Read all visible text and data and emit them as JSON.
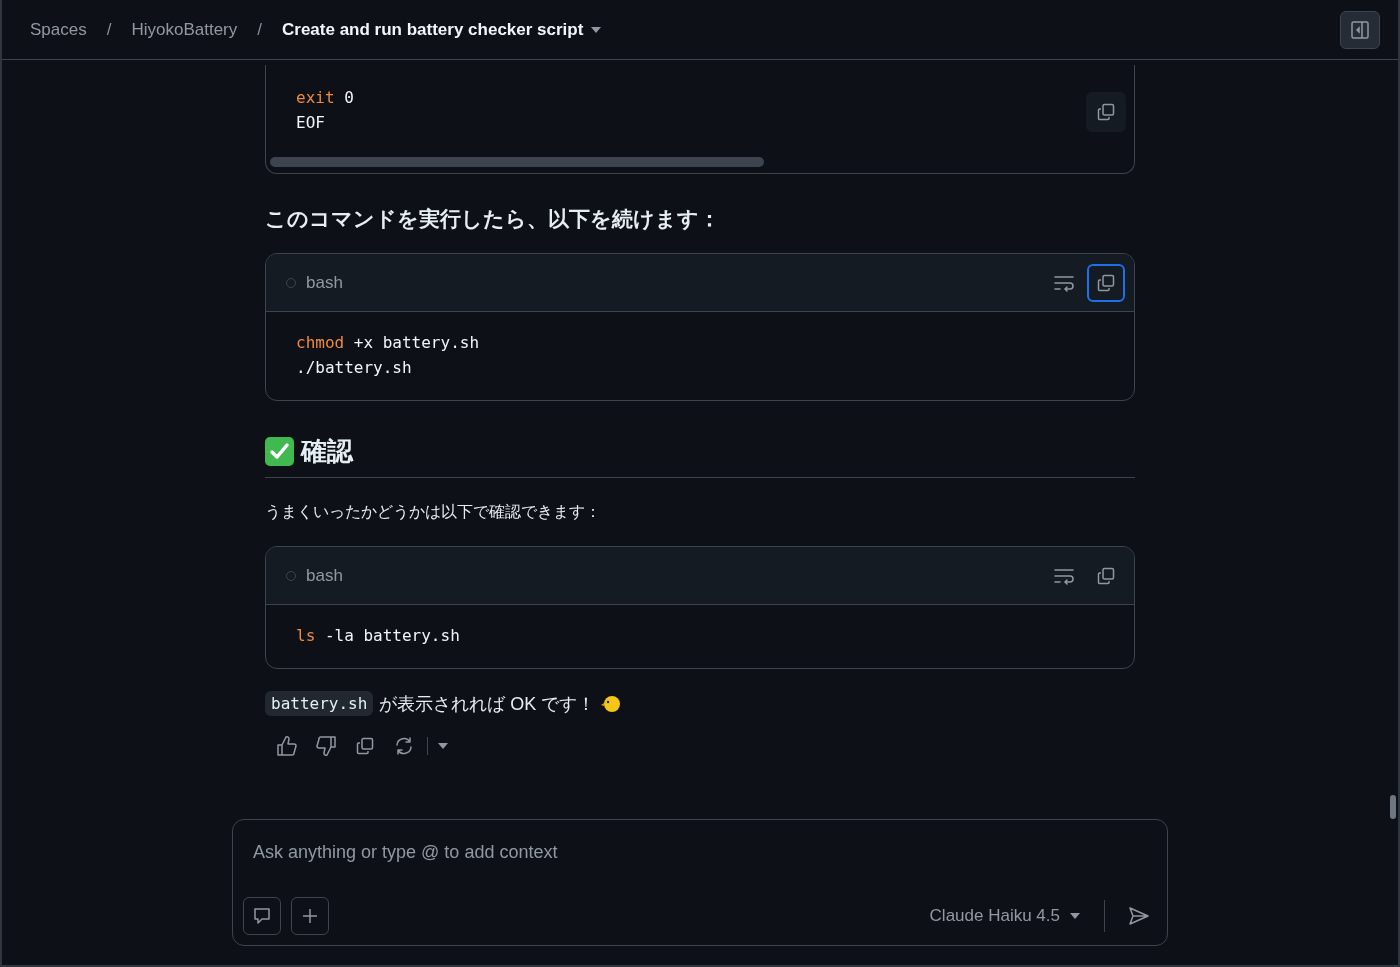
{
  "breadcrumb": [
    {
      "label": "Spaces",
      "current": false
    },
    {
      "label": "/",
      "kind": "separator"
    },
    {
      "label": "HiyokoBattery",
      "current": false
    },
    {
      "label": "/",
      "kind": "separator"
    },
    {
      "label": "Create and run battery checker script",
      "current": true
    }
  ],
  "blocks": [
    {
      "kind": "code",
      "header": false,
      "copy_focused": false,
      "scrollbar": true,
      "lines": [
        [
          {
            "text": "exit",
            "kind": "command"
          },
          {
            "text": " 0",
            "kind": "plain"
          }
        ],
        [
          {
            "text": "EOF",
            "kind": "plain"
          }
        ]
      ]
    },
    {
      "kind": "lead",
      "text": "このコマンドを実行したら、以下を続けます："
    },
    {
      "kind": "code",
      "header": true,
      "language": "bash",
      "copy_focused": true,
      "scrollbar": false,
      "lines": [
        [
          {
            "text": "chmod",
            "kind": "command"
          },
          {
            "text": " +x battery.sh",
            "kind": "plain"
          }
        ],
        [
          {
            "text": "./battery.sh",
            "kind": "plain"
          }
        ]
      ]
    },
    {
      "kind": "heading",
      "text": "確認"
    },
    {
      "kind": "paragraph",
      "text": "うまくいったかどうかは以下で確認できます："
    },
    {
      "kind": "code",
      "header": true,
      "language": "bash",
      "copy_focused": false,
      "scrollbar": false,
      "lines": [
        [
          {
            "text": "ls",
            "kind": "command"
          },
          {
            "text": " -la battery.sh",
            "kind": "plain"
          }
        ]
      ]
    },
    {
      "kind": "result",
      "code": "battery.sh",
      "text": "が表示されれば OK です！"
    }
  ],
  "composer": {
    "placeholder": "Ask anything or type @ to add context",
    "model": "Claude Haiku 4.5"
  }
}
